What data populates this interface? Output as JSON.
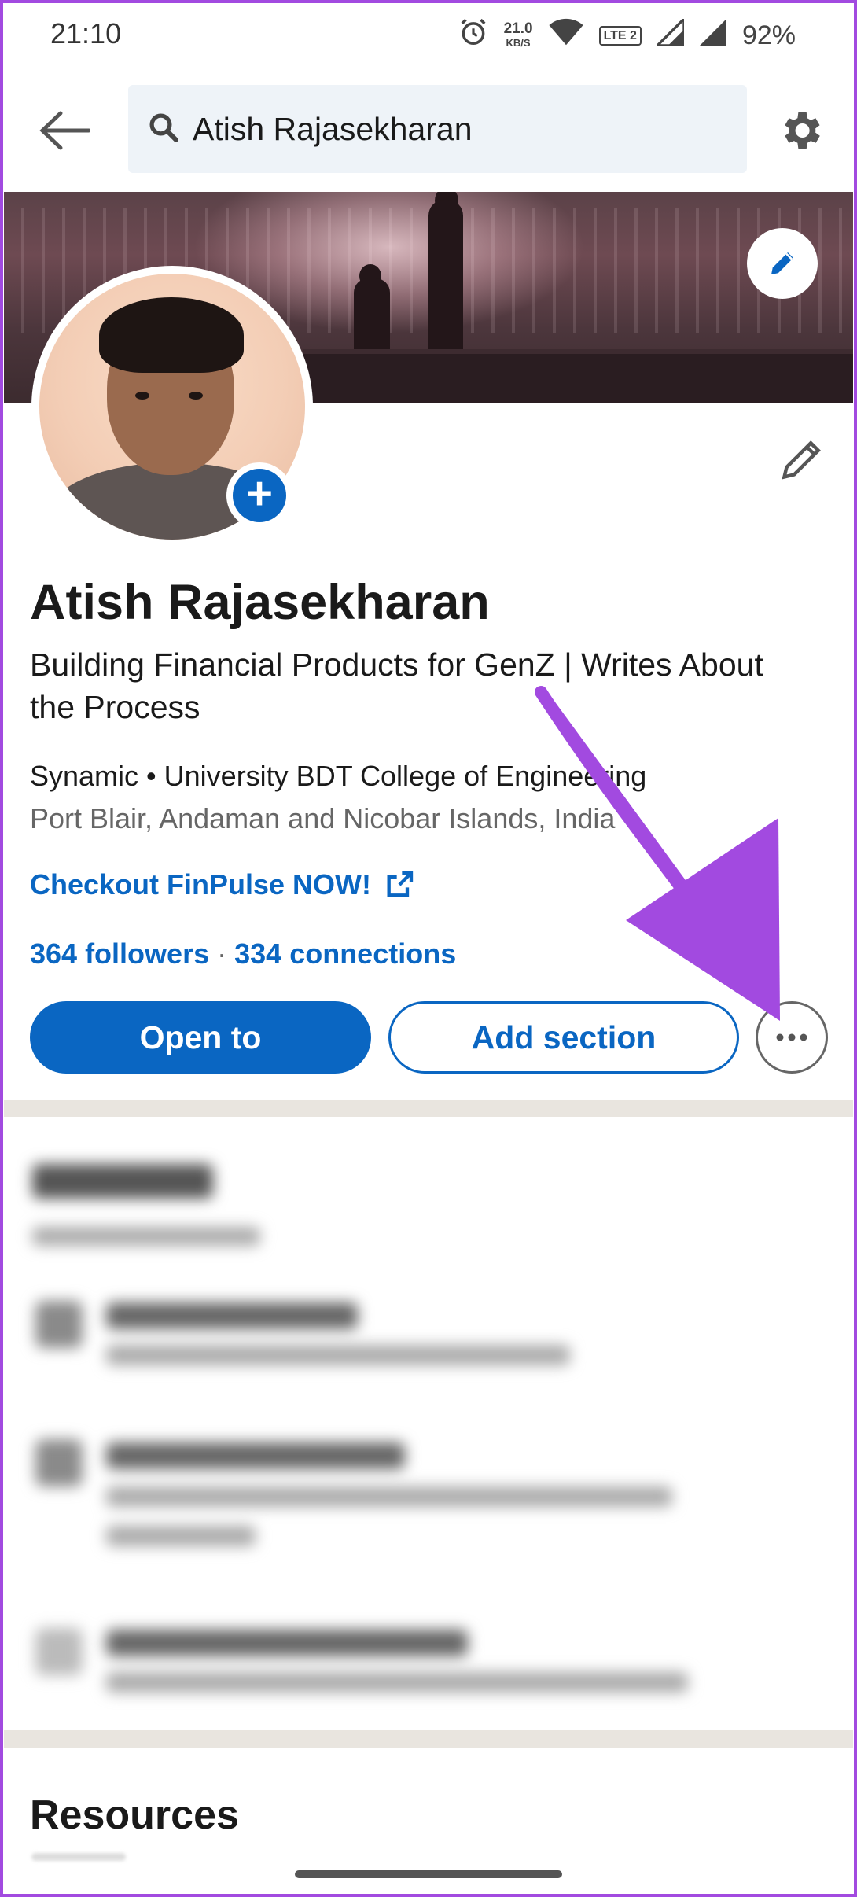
{
  "status_bar": {
    "time": "21:10",
    "net_speed_value": "21.0",
    "net_speed_unit": "KB/S",
    "network_label": "LTE 2",
    "battery": "92%"
  },
  "search": {
    "value": "Atish Rajasekharan"
  },
  "profile": {
    "name": "Atish Rajasekharan",
    "headline": "Building Financial Products for GenZ | Writes About the Process",
    "org": "Synamic • University BDT College of Engineering",
    "location": "Port Blair, Andaman and Nicobar Islands, India",
    "link_label": "Checkout FinPulse NOW!",
    "followers": "364 followers",
    "separator": "·",
    "connections": "334 connections"
  },
  "actions": {
    "open_to": "Open to",
    "add_section": "Add section"
  },
  "resources": {
    "title": "Resources"
  },
  "colors": {
    "accent": "#0a66c2",
    "annotation": "#a24ae0"
  }
}
